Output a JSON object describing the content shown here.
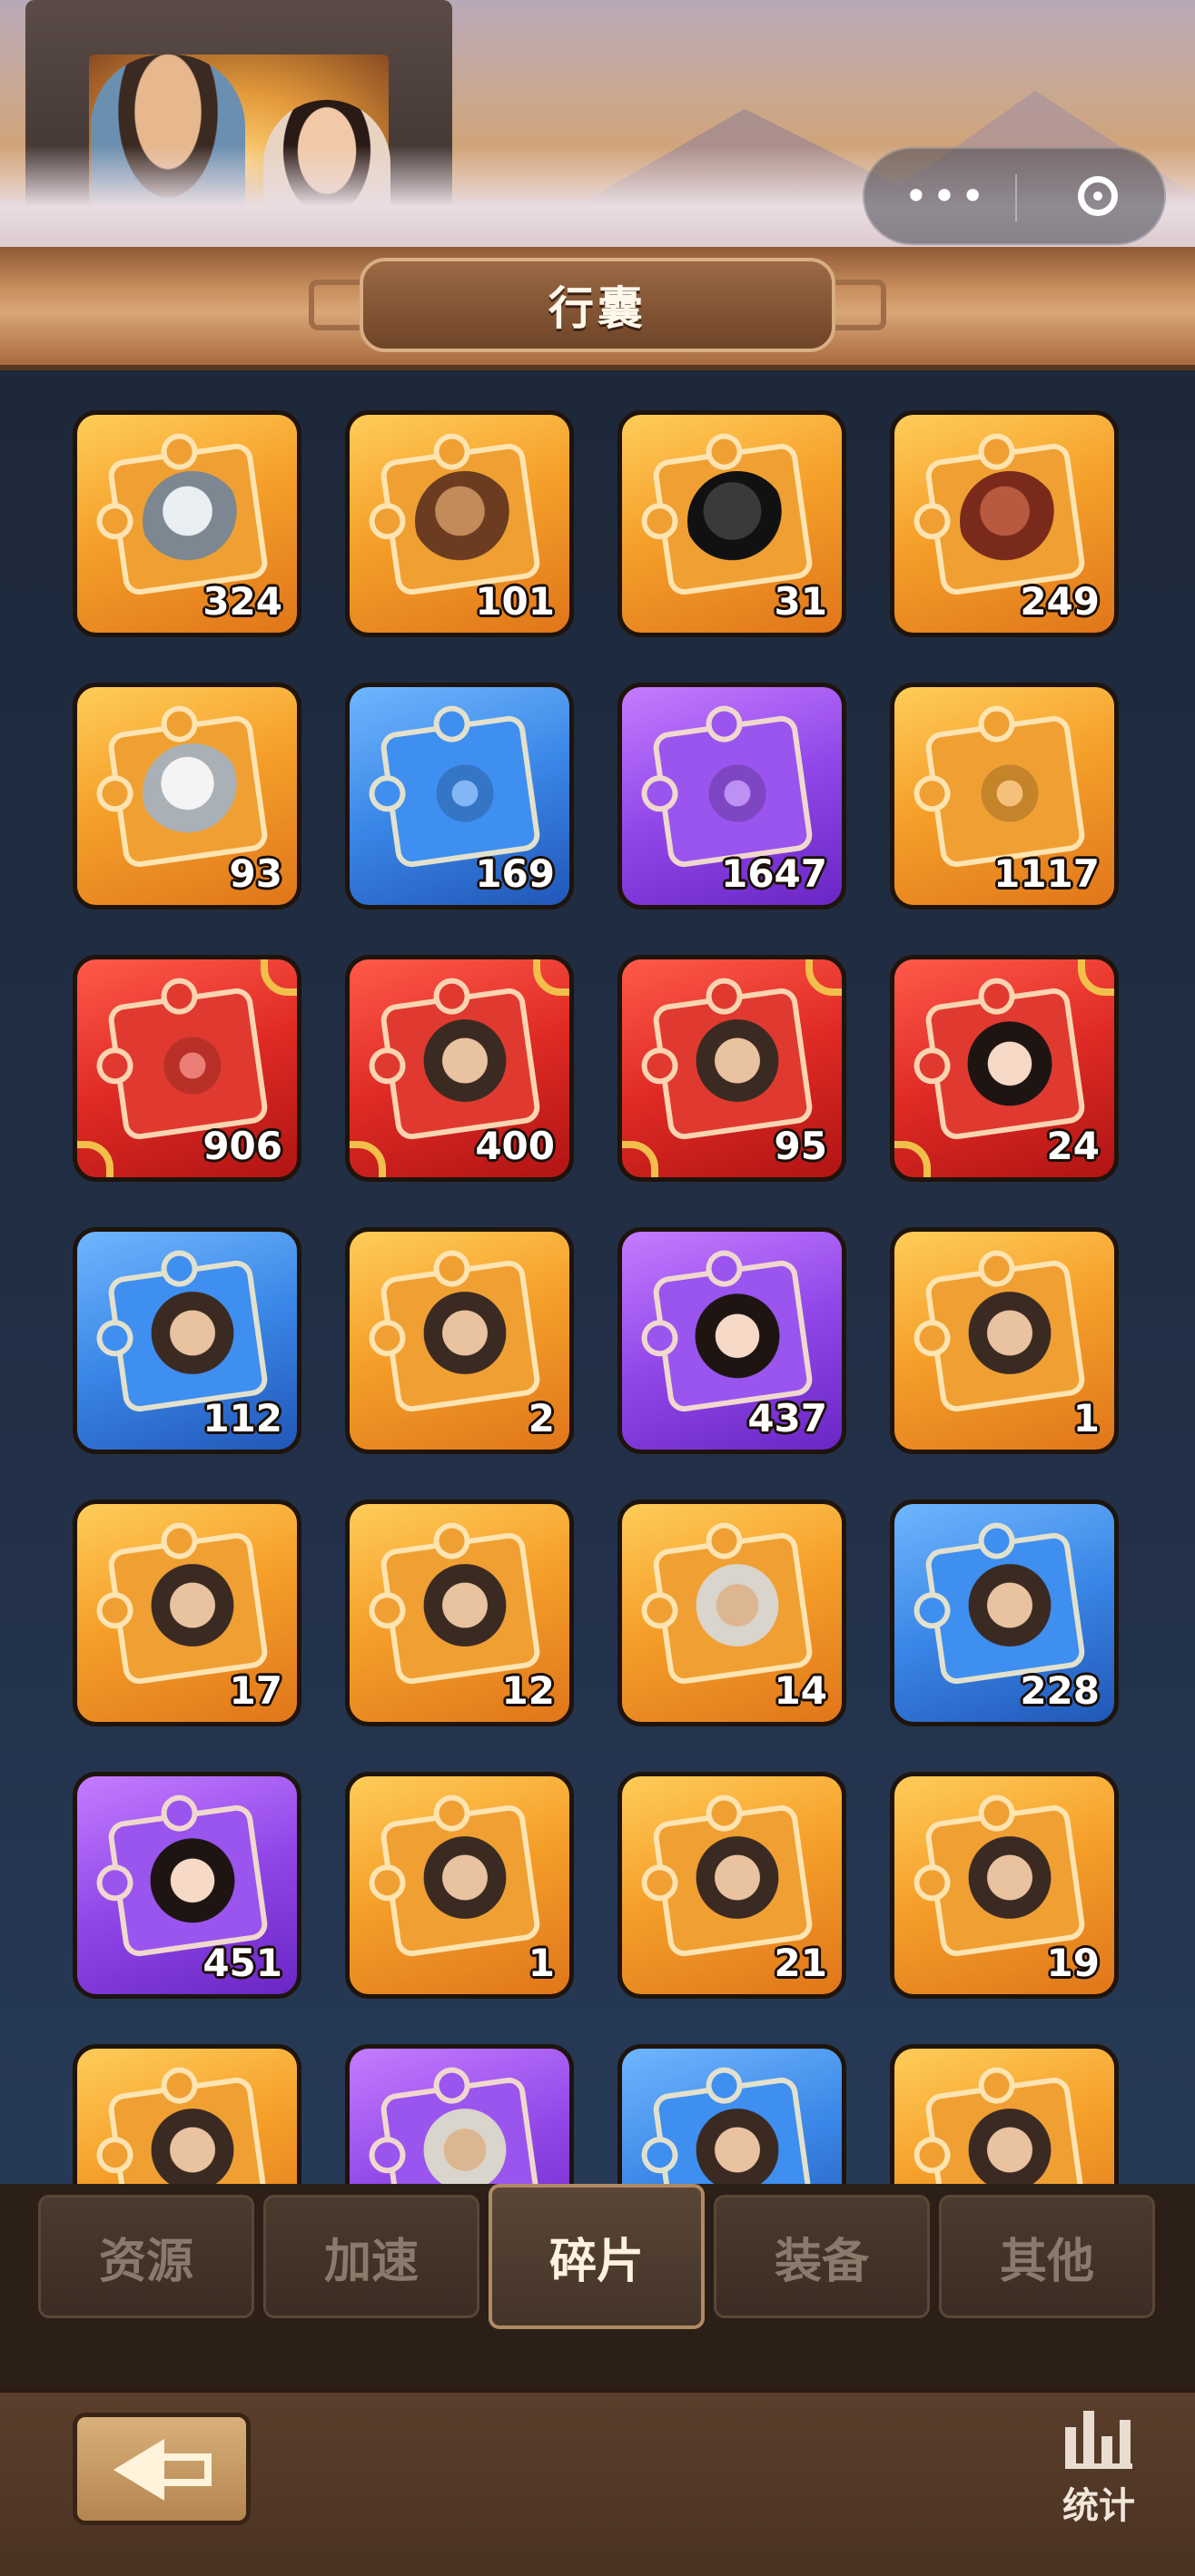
{
  "header": {
    "capsule": {
      "more_icon": "more-dots-icon",
      "close_icon": "target-close-icon"
    }
  },
  "title": "行囊",
  "items": [
    {
      "count": "324",
      "rarity": "orange",
      "art": "horse-gray"
    },
    {
      "count": "101",
      "rarity": "orange",
      "art": "horse-brown"
    },
    {
      "count": "31",
      "rarity": "orange",
      "art": "horse-black"
    },
    {
      "count": "249",
      "rarity": "orange",
      "art": "horse-red"
    },
    {
      "count": "93",
      "rarity": "orange",
      "art": "horse-white"
    },
    {
      "count": "169",
      "rarity": "blue",
      "art": "emblem"
    },
    {
      "count": "1647",
      "rarity": "purple",
      "art": "emblem"
    },
    {
      "count": "1117",
      "rarity": "orange",
      "art": "emblem"
    },
    {
      "count": "906",
      "rarity": "red",
      "art": "emblem"
    },
    {
      "count": "400",
      "rarity": "red",
      "art": "face"
    },
    {
      "count": "95",
      "rarity": "red",
      "art": "face"
    },
    {
      "count": "24",
      "rarity": "red",
      "art": "face-f"
    },
    {
      "count": "112",
      "rarity": "blue",
      "art": "face"
    },
    {
      "count": "2",
      "rarity": "orange",
      "art": "face"
    },
    {
      "count": "437",
      "rarity": "purple",
      "art": "face-f"
    },
    {
      "count": "1",
      "rarity": "orange",
      "art": "face"
    },
    {
      "count": "17",
      "rarity": "orange",
      "art": "face"
    },
    {
      "count": "12",
      "rarity": "orange",
      "art": "face"
    },
    {
      "count": "14",
      "rarity": "orange",
      "art": "face-old"
    },
    {
      "count": "228",
      "rarity": "blue",
      "art": "face"
    },
    {
      "count": "451",
      "rarity": "purple",
      "art": "face-f"
    },
    {
      "count": "1",
      "rarity": "orange",
      "art": "face"
    },
    {
      "count": "21",
      "rarity": "orange",
      "art": "face"
    },
    {
      "count": "19",
      "rarity": "orange",
      "art": "face"
    },
    {
      "count": "",
      "rarity": "orange",
      "art": "face"
    },
    {
      "count": "",
      "rarity": "purple",
      "art": "face-old"
    },
    {
      "count": "",
      "rarity": "blue",
      "art": "face"
    },
    {
      "count": "",
      "rarity": "orange",
      "art": "face"
    }
  ],
  "tabs": [
    {
      "label": "资源",
      "active": false
    },
    {
      "label": "加速",
      "active": false
    },
    {
      "label": "碎片",
      "active": true
    },
    {
      "label": "装备",
      "active": false
    },
    {
      "label": "其他",
      "active": false
    }
  ],
  "bottom": {
    "back_icon": "back-arrow-icon",
    "stats_label": "统计",
    "stats_icon": "bar-chart-icon"
  },
  "colors": {
    "orange": "#f5a02a",
    "blue": "#3a86e6",
    "purple": "#9147e8",
    "red": "#df2a24",
    "background": "#1c2536"
  }
}
